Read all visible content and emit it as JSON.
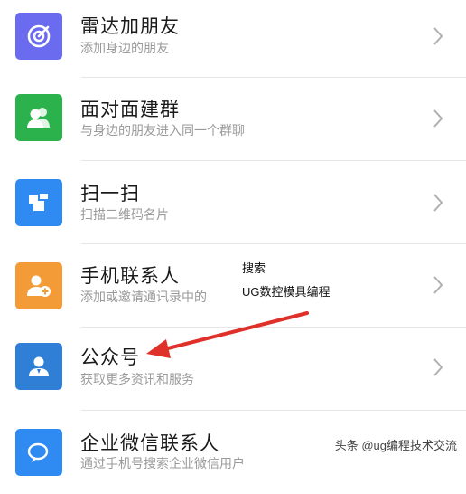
{
  "items": [
    {
      "title": "雷达加朋友",
      "subtitle": "添加身边的朋友",
      "icon": "radar-icon",
      "color": "#6b6bf0"
    },
    {
      "title": "面对面建群",
      "subtitle": "与身边的朋友进入同一个群聊",
      "icon": "group-icon",
      "color": "#2bb24c"
    },
    {
      "title": "扫一扫",
      "subtitle": "扫描二维码名片",
      "icon": "scan-icon",
      "color": "#2f8af2"
    },
    {
      "title": "手机联系人",
      "subtitle": "添加或邀请通讯录中的",
      "icon": "add-contact-icon",
      "color": "#f39b37"
    },
    {
      "title": "公众号",
      "subtitle": "获取更多资讯和服务",
      "icon": "official-account-icon",
      "color": "#2f7fd6"
    },
    {
      "title": "企业微信联系人",
      "subtitle": "通过手机号搜索企业微信用户",
      "icon": "work-wechat-icon",
      "color": "#2f8af2"
    }
  ],
  "overlay": {
    "line1": "搜索",
    "line2": "UG数控模具编程"
  },
  "watermark": "头条 @ug编程技术交流",
  "annotation": {
    "arrow_color": "#e0302a",
    "arrow_target": "公众号"
  }
}
